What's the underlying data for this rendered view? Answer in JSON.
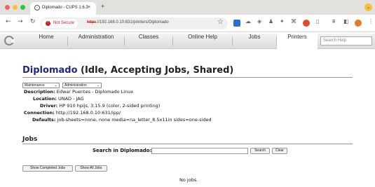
{
  "browser": {
    "tab_title": "Diplomado - CUPS 1.6.3",
    "tab_close": "×",
    "new_tab": "+",
    "security_label": "Not Secure",
    "url_scheme": "https",
    "url_rest": "://192.168.0.10:631/printers/Diplomado"
  },
  "nav": {
    "items": [
      "Home",
      "Administration",
      "Classes",
      "Online Help",
      "Jobs",
      "Printers"
    ],
    "active": "Printers",
    "search_placeholder": "Search Help"
  },
  "printer": {
    "name": "Diplomado",
    "state": "(Idle, Accepting Jobs, Shared)",
    "maintenance_select": "Maintenance",
    "administration_select": "Administration",
    "details": [
      {
        "key": "Description:",
        "value": "Edwar Puentes - Diplomado Linux"
      },
      {
        "key": "Location:",
        "value": "UNAD - JAG"
      },
      {
        "key": "Driver:",
        "value": "HP 910 hpijs, 3.15.9 (color, 2-sided printing)"
      },
      {
        "key": "Connection:",
        "value": "http://192.168.0.10:631/ipp/"
      },
      {
        "key": "Defaults:",
        "value": "job-sheets=none, none media=na_letter_8.5x11in sides=one-sided"
      }
    ]
  },
  "jobs": {
    "title": "Jobs",
    "search_label": "Search in Diplomado:",
    "search_button": "Search",
    "clear_button": "Clear",
    "show_completed_button": "Show Completed Jobs",
    "show_all_button": "Show All Jobs",
    "empty_message": "No jobs."
  },
  "colors": {
    "title_blue": "#262680",
    "not_secure_red": "#c5221f"
  }
}
